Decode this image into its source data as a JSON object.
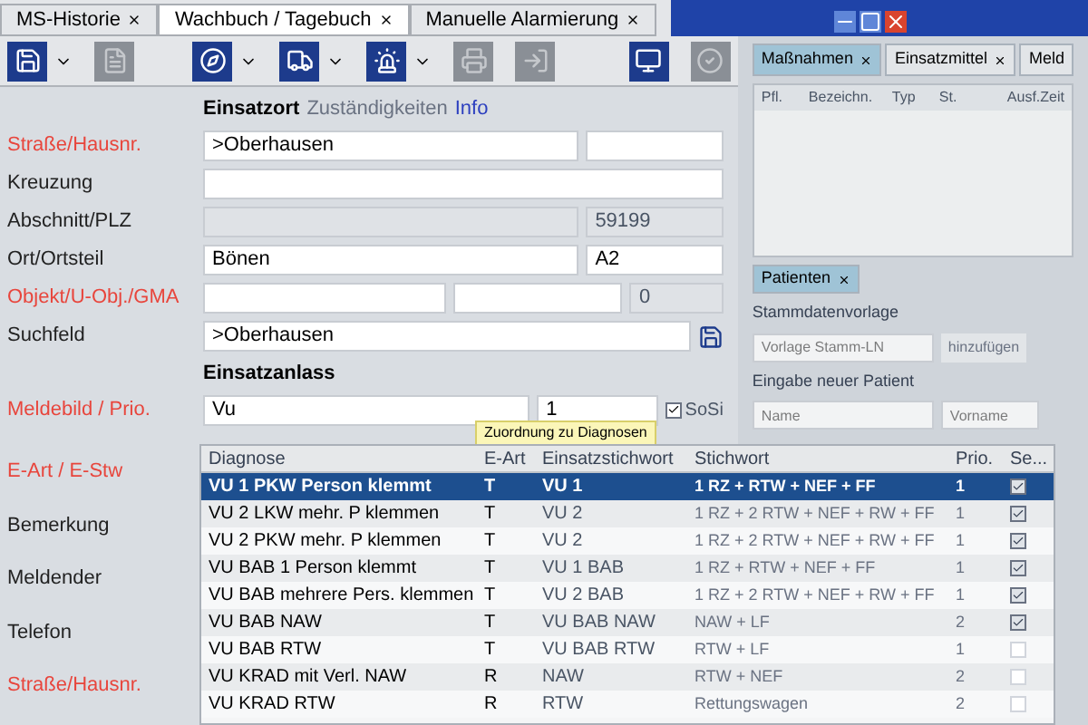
{
  "tabs": [
    {
      "label": "MS-Historie",
      "selected": false
    },
    {
      "label": "Wachbuch / Tagebuch",
      "selected": true
    },
    {
      "label": "Manuelle Alarmierung",
      "selected": false
    }
  ],
  "section_tabs": [
    {
      "label": "Einsatzort",
      "kind": "tab",
      "selected": true
    },
    {
      "label": "Zuständigkeiten",
      "kind": "tab",
      "selected": false
    },
    {
      "label": "Info",
      "kind": "link",
      "selected": false
    }
  ],
  "form": {
    "rows": [
      {
        "label": "Straße/Hausnr.",
        "required": true,
        "fields": [
          {
            "value": ">Oberhausen",
            "readonly": false
          },
          {
            "readonly": false
          }
        ]
      },
      {
        "label": "Kreuzung",
        "required": false,
        "fields": [
          {
            "readonly": false
          }
        ]
      },
      {
        "label": "Abschnitt/PLZ",
        "required": false,
        "fields": [
          {
            "readonly": true
          },
          {
            "value": "59199",
            "readonly": true
          }
        ]
      },
      {
        "label": "Ort/Ortsteil",
        "required": false,
        "fields": [
          {
            "value": "Bönen",
            "readonly": false
          },
          {
            "value": "A2",
            "readonly": false
          }
        ]
      },
      {
        "label": "Objekt/U-Obj./GMA",
        "required": true,
        "fields": [
          {
            "readonly": false
          },
          {
            "readonly": false
          },
          {
            "value": "0",
            "readonly": true
          }
        ]
      },
      {
        "label": "Suchfeld",
        "required": false,
        "search": true,
        "fields": [
          {
            "value": ">Oberhausen",
            "readonly": false
          }
        ]
      }
    ]
  },
  "anlass": {
    "title": "Einsatzanlass",
    "label": "Meldebild / Prio.",
    "required": true,
    "meldebild": "Vu",
    "prio": "1",
    "sosi": {
      "label": "SoSi",
      "checked": true
    },
    "tooltip": "Zuordnung zu Diagnosen"
  },
  "more_labels": [
    {
      "label": "E-Art / E-Stw",
      "required": true
    },
    {
      "label": "Bemerkung",
      "required": false
    },
    {
      "label": "Meldender",
      "required": false
    },
    {
      "label": "Telefon",
      "required": false
    },
    {
      "label": "Straße/Hausnr.",
      "required": true
    }
  ],
  "right_panel": {
    "tabs": [
      {
        "label": "Maßnahmen",
        "selected": true
      },
      {
        "label": "Einsatzmittel",
        "selected": false
      },
      {
        "label": "Meld",
        "selected": false
      }
    ],
    "columns": [
      "Pfl.",
      "Bezeichn.",
      "Typ",
      "St.",
      "Ausf.Zeit"
    ],
    "patients_tab": "Patienten",
    "template_label": "Stammdatenvorlage",
    "template_placeholder": "Vorlage Stamm-LN",
    "add_button": "hinzufügen",
    "new_label": "Eingabe neuer Patient",
    "name_placeholder": "Name",
    "first_name_placeholder": "Vorname"
  },
  "diagnoses": {
    "columns": [
      "Diagnose",
      "E-Art",
      "Einsatzstichwort",
      "Stichwort",
      "Prio.",
      "Se..."
    ],
    "rows": [
      {
        "diagnose": "VU 1 PKW Person klemmt",
        "art": "T",
        "einsatzstichwort": "VU 1",
        "stichwort": "1 RZ + RTW + NEF + FF",
        "prio": "1",
        "checked": true,
        "selected": true
      },
      {
        "diagnose": "VU 2 LKW mehr. P klemmen",
        "art": "T",
        "einsatzstichwort": "VU 2",
        "stichwort": "1 RZ + 2 RTW + NEF + RW + FF",
        "prio": "1",
        "checked": true,
        "selected": false
      },
      {
        "diagnose": "VU 2 PKW mehr. P klemmen",
        "art": "T",
        "einsatzstichwort": "VU 2",
        "stichwort": "1 RZ + 2 RTW + NEF + RW + FF",
        "prio": "1",
        "checked": true,
        "selected": false
      },
      {
        "diagnose": "VU BAB  1 Person klemmt",
        "art": "T",
        "einsatzstichwort": "VU 1 BAB",
        "stichwort": "1 RZ + RTW + NEF + FF",
        "prio": "1",
        "checked": true,
        "selected": false
      },
      {
        "diagnose": "VU BAB mehrere Pers. klemmen",
        "art": "T",
        "einsatzstichwort": "VU 2 BAB",
        "stichwort": "1 RZ + 2 RTW + NEF + RW + FF",
        "prio": "1",
        "checked": true,
        "selected": false
      },
      {
        "diagnose": "VU BAB NAW",
        "art": "T",
        "einsatzstichwort": "VU BAB NAW",
        "stichwort": "NAW + LF",
        "prio": "2",
        "checked": true,
        "selected": false
      },
      {
        "diagnose": "VU BAB RTW",
        "art": "T",
        "einsatzstichwort": "VU BAB RTW",
        "stichwort": "RTW + LF",
        "prio": "1",
        "checked": false,
        "selected": false
      },
      {
        "diagnose": "VU KRAD mit Verl. NAW",
        "art": "R",
        "einsatzstichwort": "NAW",
        "stichwort": "RTW + NEF",
        "prio": "2",
        "checked": false,
        "selected": false
      },
      {
        "diagnose": "VU KRAD RTW",
        "art": "R",
        "einsatzstichwort": "RTW",
        "stichwort": "Rettungswagen",
        "prio": "2",
        "checked": false,
        "selected": false
      }
    ]
  }
}
